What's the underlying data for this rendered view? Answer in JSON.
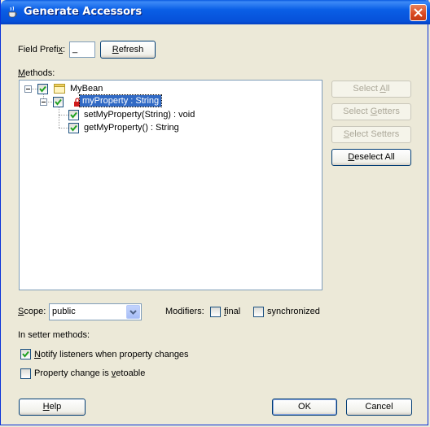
{
  "window": {
    "title": "Generate Accessors"
  },
  "field_prefix": {
    "label_pre": "Field Prefi",
    "label_key": "x",
    "label_post": ":",
    "value": "_"
  },
  "refresh_button": {
    "key": "R",
    "rest": "efresh"
  },
  "methods": {
    "key": "M",
    "rest": "ethods:"
  },
  "tree": {
    "root": "MyBean",
    "property": "myProperty : String",
    "setter": "setMyProperty(String) : void",
    "getter": "getMyProperty() : String"
  },
  "side_buttons": {
    "select_all": {
      "pre": "Select ",
      "key": "A",
      "post": "ll"
    },
    "select_getters": {
      "pre": "Select ",
      "key": "G",
      "post": "etters"
    },
    "select_setters": {
      "pre": "",
      "key": "S",
      "post": "elect Setters"
    },
    "deselect_all": {
      "pre": "",
      "key": "D",
      "post": "eselect All"
    }
  },
  "scope": {
    "label_key": "S",
    "label_rest": "cope:",
    "value": "public"
  },
  "modifiers": {
    "label": "Modifiers:",
    "final": {
      "key": "f",
      "rest": "inal",
      "checked": false
    },
    "synchronized": {
      "label": "synchronized",
      "checked": false
    }
  },
  "setter_section": {
    "label": "In setter methods:"
  },
  "notify": {
    "key": "N",
    "rest": "otify listeners when property changes",
    "checked": true
  },
  "vetoable": {
    "pre": "Property change is ",
    "key": "v",
    "post": "etoable",
    "checked": false
  },
  "footer": {
    "help": {
      "key": "H",
      "rest": "elp"
    },
    "ok": "OK",
    "cancel": "Cancel"
  },
  "colors": {
    "title_bar": "#0a5fe6",
    "selection": "#316ac5",
    "dialog_bg": "#ece9d8",
    "check": "#21a121"
  }
}
